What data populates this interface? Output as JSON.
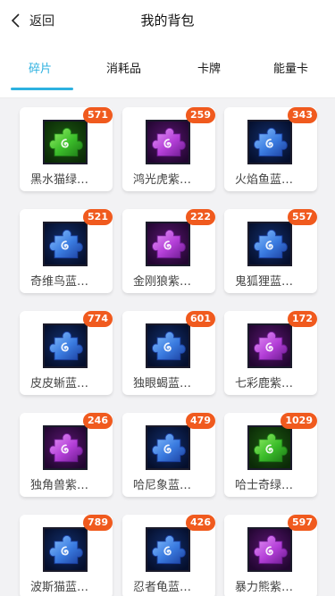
{
  "header": {
    "back_label": "返回",
    "title": "我的背包"
  },
  "tabs": [
    {
      "label": "碎片",
      "active": true
    },
    {
      "label": "消耗品",
      "active": false
    },
    {
      "label": "卡牌",
      "active": false
    },
    {
      "label": "能量卡",
      "active": false
    }
  ],
  "colors": {
    "accent": "#2db1e0",
    "badge": "#f05a1e",
    "rarity": {
      "green": "#3cc83a",
      "purple": "#b23ad6",
      "blue": "#2b63d8"
    }
  },
  "items": [
    {
      "name": "黑水猫绿…",
      "count": "571",
      "rarity": "green"
    },
    {
      "name": "鸿光虎紫…",
      "count": "259",
      "rarity": "purple"
    },
    {
      "name": "火焰鱼蓝…",
      "count": "343",
      "rarity": "blue"
    },
    {
      "name": "奇维鸟蓝…",
      "count": "521",
      "rarity": "blue"
    },
    {
      "name": "金刚狼紫…",
      "count": "222",
      "rarity": "purple"
    },
    {
      "name": "鬼狐狸蓝…",
      "count": "557",
      "rarity": "blue"
    },
    {
      "name": "皮皮蜥蓝…",
      "count": "774",
      "rarity": "blue"
    },
    {
      "name": "独眼蝎蓝…",
      "count": "601",
      "rarity": "blue"
    },
    {
      "name": "七彩鹿紫…",
      "count": "172",
      "rarity": "purple"
    },
    {
      "name": "独角兽紫…",
      "count": "246",
      "rarity": "purple"
    },
    {
      "name": "哈尼象蓝…",
      "count": "479",
      "rarity": "blue"
    },
    {
      "name": "哈士奇绿…",
      "count": "1029",
      "rarity": "green"
    },
    {
      "name": "波斯猫蓝…",
      "count": "789",
      "rarity": "blue"
    },
    {
      "name": "忍者龟蓝…",
      "count": "426",
      "rarity": "blue"
    },
    {
      "name": "暴力熊紫…",
      "count": "597",
      "rarity": "purple"
    }
  ]
}
